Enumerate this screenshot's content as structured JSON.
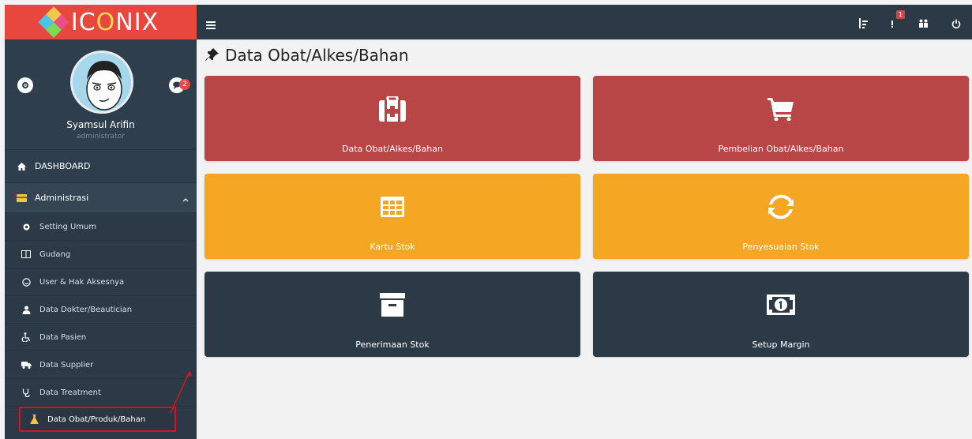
{
  "app": {
    "logo_text_1": "IC",
    "logo_text_o": "O",
    "logo_text_2": "NIX"
  },
  "profile": {
    "name": "Syamsul Arifin",
    "role": "administrator",
    "chat_count": "2"
  },
  "sidebar": {
    "dashboard": "DASHBOARD",
    "admin": "Administrasi",
    "items": [
      {
        "label": "Setting Umum",
        "icon": "gear-icon"
      },
      {
        "label": "Gudang",
        "icon": "columns-icon"
      },
      {
        "label": "User & Hak Aksesnya",
        "icon": "smile-icon"
      },
      {
        "label": "Data Dokter/Beautician",
        "icon": "doctor-icon"
      },
      {
        "label": "Data Pasien",
        "icon": "wheelchair-icon"
      },
      {
        "label": "Data Supplier",
        "icon": "truck-icon"
      },
      {
        "label": "Data Treatment",
        "icon": "stethoscope-icon"
      },
      {
        "label": "Data Obat/Produk/Bahan",
        "icon": "flask-icon"
      }
    ]
  },
  "topbar": {
    "notification_count": "1"
  },
  "page": {
    "title": "Data Obat/Alkes/Bahan"
  },
  "tiles": [
    {
      "label": "Data Obat/Alkes/Bahan",
      "icon": "medkit-icon",
      "color": "#b94646"
    },
    {
      "label": "Pembelian Obat/Alkes/Bahan",
      "icon": "cart-icon",
      "color": "#b94646"
    },
    {
      "label": "Kartu Stok",
      "icon": "table-icon",
      "color": "#f5a623"
    },
    {
      "label": "Penyesuaian Stok",
      "icon": "refresh-icon",
      "color": "#f5a623"
    },
    {
      "label": "Penerimaan Stok",
      "icon": "archive-icon",
      "color": "#2c3a47"
    },
    {
      "label": "Setup Margin",
      "icon": "money-icon",
      "color": "#2c3a47"
    }
  ],
  "colors": {
    "sidebar": "#2c3a47",
    "logo_bg": "#e8473d",
    "highlight_border": "#d8151d"
  }
}
